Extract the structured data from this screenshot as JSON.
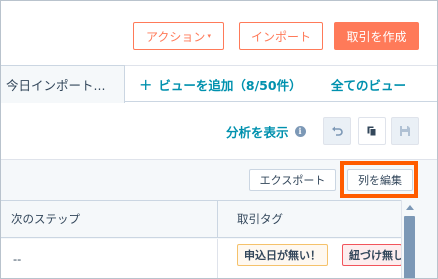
{
  "header": {
    "actions_label": "アクション",
    "actions_caret": "▾",
    "import_label": "インポート",
    "create_deal_label": "取引を作成"
  },
  "tabs": {
    "active_label": "今日インポート...",
    "add_view_plus": "+",
    "add_view_label": "ビューを追加（8/50件）",
    "all_views_label": "全てのビュー"
  },
  "toolbar": {
    "analysis_label": "分析を表示",
    "info_glyph": "i"
  },
  "table_toolbar": {
    "export_label": "エクスポート",
    "edit_columns_label": "列を編集"
  },
  "table": {
    "columns": [
      "次のステップ",
      "取引タグ"
    ],
    "rows": [
      {
        "next_step": "--",
        "tags": [
          "申込日が無い！",
          "紐づけ無し"
        ]
      }
    ]
  },
  "colors": {
    "accent": "#ff7a59",
    "link": "#0091ae",
    "highlight_box": "#ff5c00"
  }
}
